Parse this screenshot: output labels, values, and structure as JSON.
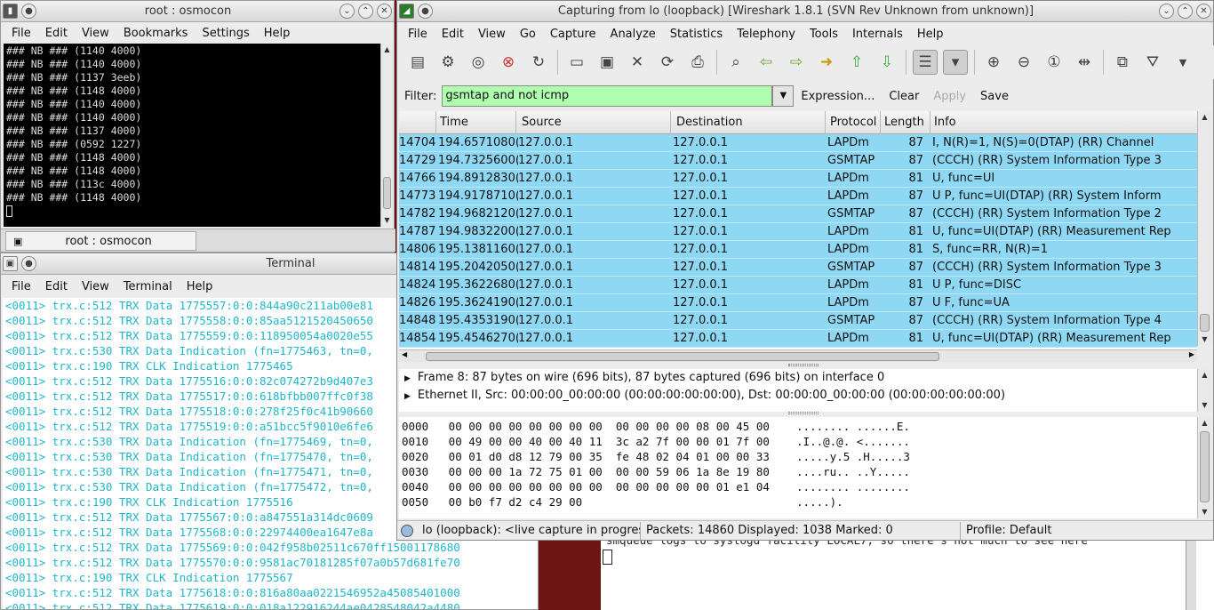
{
  "konsole": {
    "title": "root : osmocon",
    "menu": [
      "File",
      "Edit",
      "View",
      "Bookmarks",
      "Settings",
      "Help"
    ],
    "lines": [
      "### NB ### (1140 4000)",
      "### NB ### (1140 4000)",
      "### NB ### (1137 3eeb)",
      "### NB ### (1148 4000)",
      "### NB ### (1140 4000)",
      "### NB ### (1140 4000)",
      "### NB ### (1137 4000)",
      "### NB ### (0592 1227)",
      "### NB ### (1148 4000)",
      "### NB ### (1148 4000)",
      "### NB ### (113c 4000)",
      "### NB ### (1148 4000)"
    ],
    "tab_label": "root : osmocon"
  },
  "terminal": {
    "title": "Terminal",
    "menu": [
      "File",
      "Edit",
      "View",
      "Terminal",
      "Help"
    ],
    "lines": [
      "<0011> trx.c:512 TRX Data 1775557:0:0:844a90c211ab00e81",
      "<0011> trx.c:512 TRX Data 1775558:0:0:85aa5121520450650",
      "<0011> trx.c:512 TRX Data 1775559:0:0:118950054a0020e55",
      "<0011> trx.c:530 TRX Data Indication (fn=1775463, tn=0,",
      "<0011> trx.c:190 TRX CLK Indication 1775465",
      "<0011> trx.c:512 TRX Data 1775516:0:0:82c074272b9d407e3",
      "<0011> trx.c:512 TRX Data 1775517:0:0:618bfbb007ffc0f38",
      "<0011> trx.c:512 TRX Data 1775518:0:0:278f25f0c41b90660",
      "<0011> trx.c:512 TRX Data 1775519:0:0:a51bcc5f9010e6fe6",
      "<0011> trx.c:530 TRX Data Indication (fn=1775469, tn=0,",
      "<0011> trx.c:530 TRX Data Indication (fn=1775470, tn=0,",
      "<0011> trx.c:530 TRX Data Indication (fn=1775471, tn=0,",
      "<0011> trx.c:530 TRX Data Indication (fn=1775472, tn=0,",
      "<0011> trx.c:190 TRX CLK Indication 1775516",
      "<0011> trx.c:512 TRX Data 1775567:0:0:a847551a314dc0609",
      "<0011> trx.c:512 TRX Data 1775568:0:0:22974400ea1647e8a",
      "<0011> trx.c:512 TRX Data 1775569:0:0:042f958b02511c670ff15001178680",
      "<0011> trx.c:512 TRX Data 1775570:0:0:9581ac70181285f07a0b57d681fe70",
      "<0011> trx.c:190 TRX CLK Indication 1775567",
      "<0011> trx.c:512 TRX Data 1775618:0:0:816a80aa0221546952a45085401000",
      "<0011> trx.c:512 TRX Data 1775619:0:0:018a122916244ae0428548042a4480"
    ]
  },
  "bgwin": {
    "text": "smqueue logs to syslogd facility LOCAL7, so there's not much to see here"
  },
  "wireshark": {
    "title": "Capturing from lo (loopback)   [Wireshark 1.8.1  (SVN Rev Unknown from unknown)]",
    "menu": [
      "File",
      "Edit",
      "View",
      "Go",
      "Capture",
      "Analyze",
      "Statistics",
      "Telephony",
      "Tools",
      "Internals",
      "Help"
    ],
    "filter_label": "Filter:",
    "filter_value": "gsmtap and not icmp",
    "filter_expression": "Expression...",
    "filter_clear": "Clear",
    "filter_apply": "Apply",
    "filter_save": "Save",
    "columns": [
      "Time",
      "Source",
      "Destination",
      "Protocol",
      "Length",
      "Info"
    ],
    "packets": [
      {
        "no": "14704",
        "time": "194.6571080(",
        "src": "127.0.0.1",
        "dst": "127.0.0.1",
        "proto": "LAPDm",
        "len": "87",
        "info": "I, N(R)=1, N(S)=0(DTAP) (RR) Channel"
      },
      {
        "no": "14729",
        "time": "194.7325600(",
        "src": "127.0.0.1",
        "dst": "127.0.0.1",
        "proto": "GSMTAP",
        "len": "87",
        "info": "(CCCH) (RR) System Information Type 3"
      },
      {
        "no": "14766",
        "time": "194.8912830(",
        "src": "127.0.0.1",
        "dst": "127.0.0.1",
        "proto": "LAPDm",
        "len": "81",
        "info": "U, func=UI"
      },
      {
        "no": "14773",
        "time": "194.9178710(",
        "src": "127.0.0.1",
        "dst": "127.0.0.1",
        "proto": "LAPDm",
        "len": "87",
        "info": "U P, func=UI(DTAP) (RR) System Inform"
      },
      {
        "no": "14782",
        "time": "194.9682120(",
        "src": "127.0.0.1",
        "dst": "127.0.0.1",
        "proto": "GSMTAP",
        "len": "87",
        "info": "(CCCH) (RR) System Information Type 2"
      },
      {
        "no": "14787",
        "time": "194.9832200(",
        "src": "127.0.0.1",
        "dst": "127.0.0.1",
        "proto": "LAPDm",
        "len": "81",
        "info": "U, func=UI(DTAP) (RR) Measurement Rep"
      },
      {
        "no": "14806",
        "time": "195.1381160(",
        "src": "127.0.0.1",
        "dst": "127.0.0.1",
        "proto": "LAPDm",
        "len": "81",
        "info": "S, func=RR, N(R)=1"
      },
      {
        "no": "14814",
        "time": "195.2042050(",
        "src": "127.0.0.1",
        "dst": "127.0.0.1",
        "proto": "GSMTAP",
        "len": "87",
        "info": "(CCCH) (RR) System Information Type 3"
      },
      {
        "no": "14824",
        "time": "195.3622680(",
        "src": "127.0.0.1",
        "dst": "127.0.0.1",
        "proto": "LAPDm",
        "len": "81",
        "info": "U P, func=DISC"
      },
      {
        "no": "14826",
        "time": "195.3624190(",
        "src": "127.0.0.1",
        "dst": "127.0.0.1",
        "proto": "LAPDm",
        "len": "87",
        "info": "U F, func=UA"
      },
      {
        "no": "14848",
        "time": "195.4353190(",
        "src": "127.0.0.1",
        "dst": "127.0.0.1",
        "proto": "GSMTAP",
        "len": "87",
        "info": "(CCCH) (RR) System Information Type 4"
      },
      {
        "no": "14854",
        "time": "195.4546270(",
        "src": "127.0.0.1",
        "dst": "127.0.0.1",
        "proto": "LAPDm",
        "len": "81",
        "info": "U, func=UI(DTAP) (RR) Measurement Rep"
      }
    ],
    "details": [
      "Frame 8: 87 bytes on wire (696 bits), 87 bytes captured (696 bits) on interface 0",
      "Ethernet II, Src: 00:00:00_00:00:00 (00:00:00:00:00:00), Dst: 00:00:00_00:00:00 (00:00:00:00:00:00)"
    ],
    "bytes": [
      "0000   00 00 00 00 00 00 00 00  00 00 00 00 08 00 45 00    ........ ......E.",
      "0010   00 49 00 00 40 00 40 11  3c a2 7f 00 00 01 7f 00    .I..@.@. <.......",
      "0020   00 01 d0 d8 12 79 00 35  fe 48 02 04 01 00 00 33    .....y.5 .H.....3",
      "0030   00 00 00 1a 72 75 01 00  00 00 59 06 1a 8e 19 80    ....ru.. ..Y.....",
      "0040   00 00 00 00 00 00 00 00  00 00 00 00 00 01 e1 04    ........ ........",
      "0050   00 b0 f7 d2 c4 29 00                                .....)."
    ],
    "status_capture": "lo (loopback): <live capture in progress",
    "status_packets": "Packets: 14860 Displayed: 1038 Marked: 0",
    "status_profile": "Profile: Default",
    "filter_color": "#afffaf",
    "row_color": "#8ed8f3"
  }
}
